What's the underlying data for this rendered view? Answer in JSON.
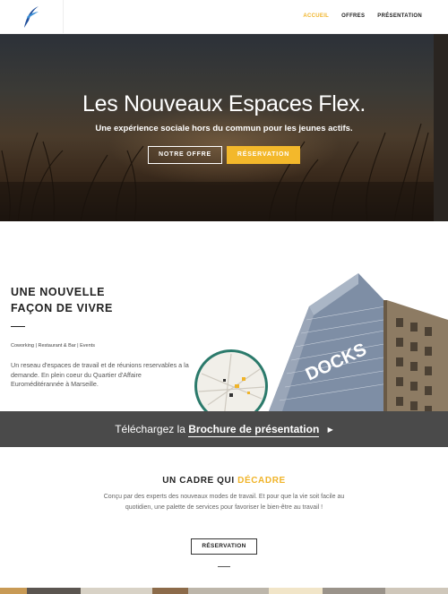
{
  "nav": {
    "items": [
      {
        "label": "ACCUEIL",
        "active": true
      },
      {
        "label": "OFFRES",
        "active": false
      },
      {
        "label": "PRÉSENTATION",
        "active": false
      }
    ]
  },
  "hero": {
    "title": "Les Nouveaux Espaces Flex.",
    "subtitle": "Une expérience sociale hors du commun pour les jeunes actifs.",
    "btn_offer": "NOTRE OFFRE",
    "btn_reservation": "RÉSERVATION"
  },
  "intro": {
    "title_line1": "UNE NOUVELLE",
    "title_line2": "FAÇON DE VIVRE",
    "tags": "Coworking | Restaurant & Bar |  Events",
    "body": "Un reseau d'espaces de travail et de réunions reservables a la demande. En plein coeur du Quartier d'Affaire Euroméditérannée à Marseille.",
    "building_sign": "DOCKS"
  },
  "banner": {
    "prefix": "Téléchargez la",
    "link": "Brochure de présentation",
    "arrow": "▶"
  },
  "cadre": {
    "title_plain": "UN CADRE QUI",
    "title_highlight": "DÉCADRE",
    "body": "Conçu par des experts des nouveaux modes de travail. Et pour que la vie soit facile au quotidien, une palette de services pour favoriser le bien-être au travail !",
    "button": "RÉSERVATION"
  },
  "colors": {
    "accent": "#f3b82b",
    "banner_bg": "#4a4a4a",
    "map_ring": "#2b7a6b"
  }
}
